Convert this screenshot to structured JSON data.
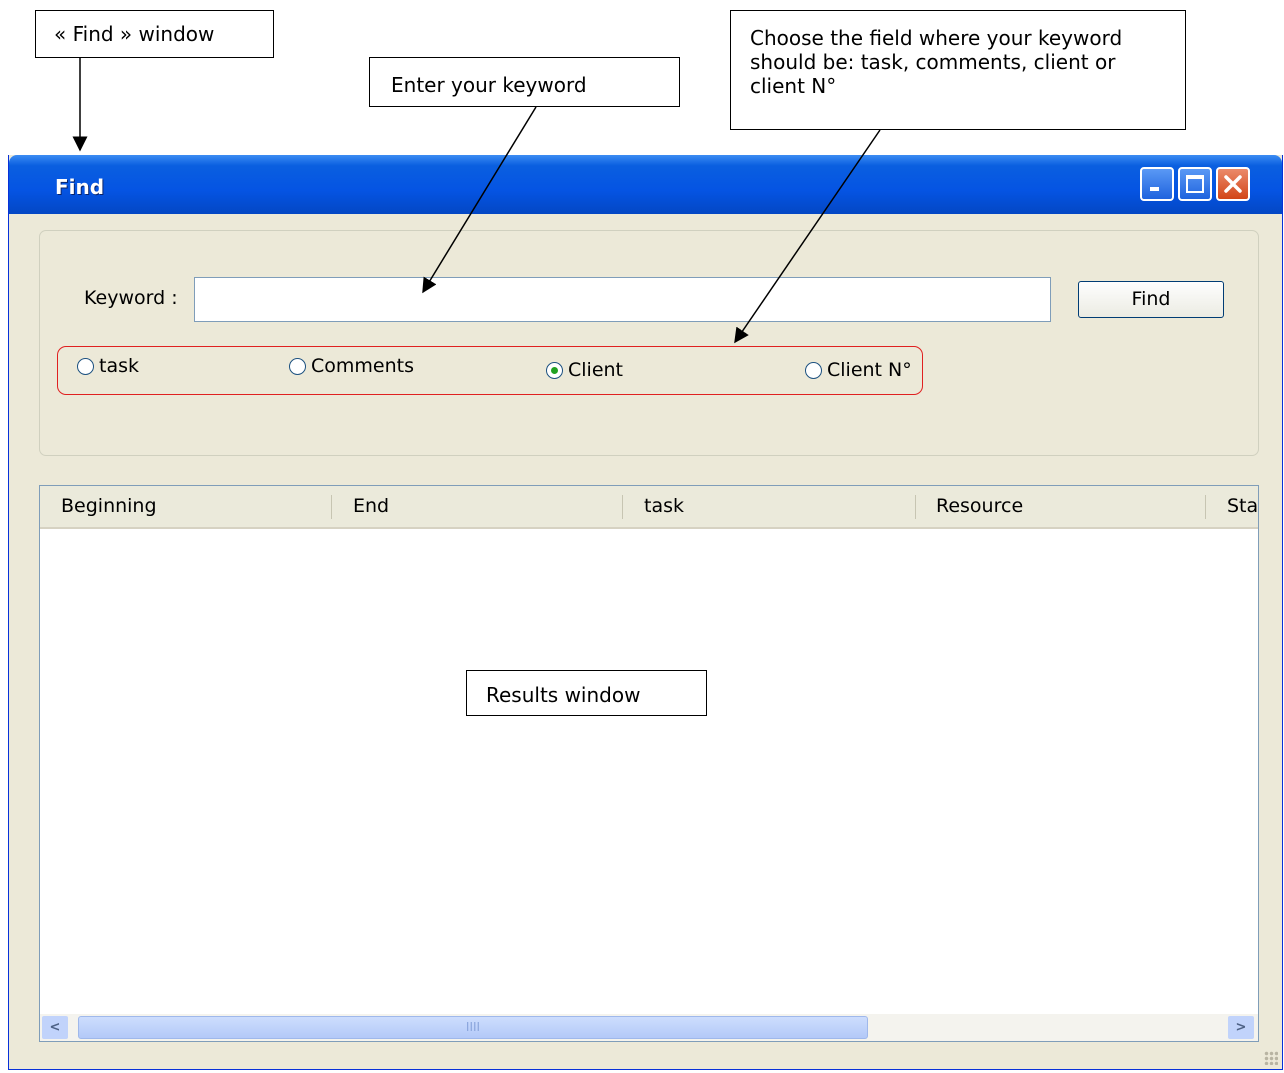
{
  "annotations": {
    "find_window": "« Find » window",
    "keyword": "Enter your keyword",
    "field": "Choose the field where your keyword should be: task, comments, client or client N°",
    "results": "Results window"
  },
  "window": {
    "title": "Find",
    "keyword_label": "Keyword :",
    "keyword_value": "",
    "find_button": "Find",
    "radios": [
      {
        "label": "task",
        "checked": false
      },
      {
        "label": "Comments",
        "checked": false
      },
      {
        "label": "Client",
        "checked": true
      },
      {
        "label": "Client N°",
        "checked": false
      }
    ],
    "columns": [
      "Beginning",
      "End",
      "task",
      "Resource",
      "Sta"
    ],
    "scrollbar_left_glyph": "<",
    "scrollbar_right_glyph": ">",
    "scrollbar_thumb_glyph": "IIII"
  },
  "colors": {
    "titlebar": "#0554e3",
    "highlight_border": "#e02020",
    "checked_radio_dot": "#21a121"
  }
}
